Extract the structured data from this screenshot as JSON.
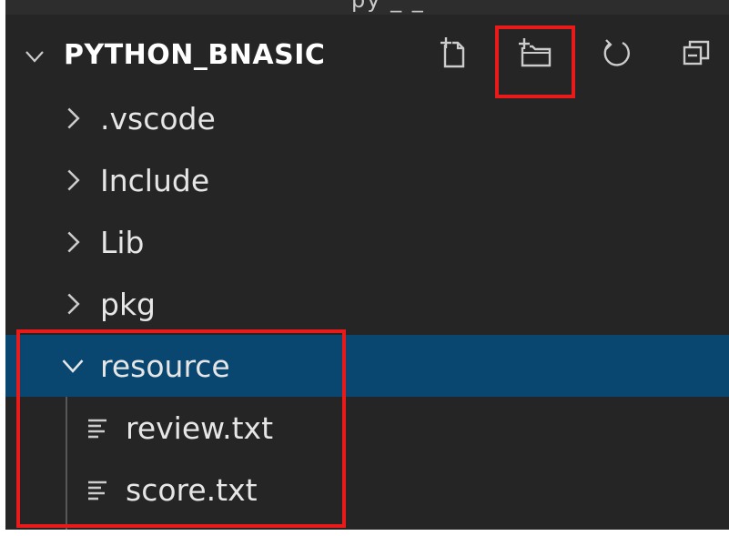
{
  "explorer": {
    "top_partial_text": "py _ _",
    "section_title": "PYTHON_BNASIC",
    "actions": [
      {
        "name": "new-file",
        "icon": "new-file-icon"
      },
      {
        "name": "new-folder",
        "icon": "new-folder-icon"
      },
      {
        "name": "refresh",
        "icon": "refresh-icon"
      },
      {
        "name": "collapse-all",
        "icon": "collapse-all-icon"
      }
    ],
    "items": [
      {
        "label": ".vscode",
        "type": "folder",
        "expanded": false
      },
      {
        "label": "Include",
        "type": "folder",
        "expanded": false
      },
      {
        "label": "Lib",
        "type": "folder",
        "expanded": false
      },
      {
        "label": "pkg",
        "type": "folder",
        "expanded": false
      },
      {
        "label": "resource",
        "type": "folder",
        "expanded": true,
        "selected": true
      },
      {
        "label": "review.txt",
        "type": "file"
      },
      {
        "label": "score.txt",
        "type": "file"
      }
    ]
  },
  "colors": {
    "background": "#252526",
    "selection": "#094771",
    "highlight": "#e81a1a",
    "text": "#e6e6e6"
  }
}
